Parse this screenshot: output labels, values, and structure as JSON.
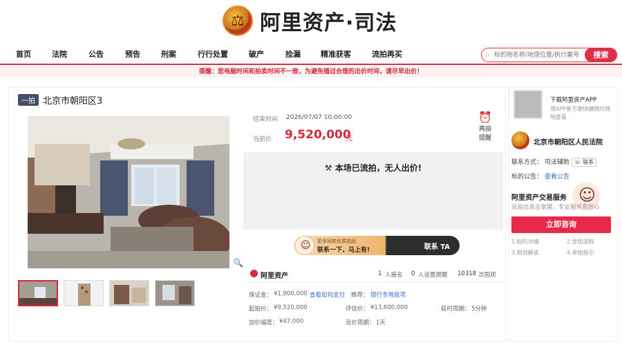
{
  "header": {
    "logo_text": "阿里资产·司法"
  },
  "nav": {
    "items": [
      "首页",
      "法院",
      "公告",
      "预告",
      "刑案",
      "行行处置",
      "破产",
      "捡漏",
      "精准获客",
      "流拍再买"
    ]
  },
  "search": {
    "placeholder": "标的物名称/地理位置/执行案号",
    "button": "搜索"
  },
  "notice": "提醒：您电脑时间和拍卖时间不一致，为避免错过合理的出价时间，请尽早出价！",
  "item": {
    "tag": "一拍",
    "title": "北京市朝阳区3",
    "end_label": "结束时间",
    "end_time": "2026/07/07 10:00:00",
    "current_label": "当前价",
    "current_price": "9,520,000",
    "currency_unit": "元",
    "remind_label_1": "再拍",
    "remind_label_2": "提醒",
    "status_text": "本场已流拍，无人出价!"
  },
  "contact": {
    "line1": "更多同类优质拍品",
    "line2": "联系一下，马上有!",
    "button": "联系 TA"
  },
  "stats": {
    "brand": "阿里资产",
    "signups": "1",
    "signups_label": "人报名",
    "reminders": "0",
    "reminders_label": "人设置提醒",
    "views": "10318",
    "views_label": "次围观"
  },
  "details": {
    "deposit_label": "保证金：",
    "deposit_value": "¥1,900,000",
    "pay_link": "查看如何支付",
    "recommend_label": "推荐：",
    "recommend_link": "银行专用款项",
    "start_label": "起拍价：",
    "start_value": "¥9,520,000",
    "appraisal_label": "评估价：",
    "appraisal_value": "¥13,600,000",
    "delay_label": "延时周期：",
    "delay_value": "5分钟",
    "increment_label": "加价幅度：",
    "increment_value": "¥47,000",
    "bid_period_label": "竞价周期：",
    "bid_period_value": "1天"
  },
  "sidebar": {
    "app_title": "下载阿里资产APP",
    "app_sub": "用APP更方便快捷随时随地查看",
    "court_name": "北京市朝阳区人民法院",
    "contact_label": "联系方式：",
    "contact_value": "司法辅助",
    "contact_chip": "联系",
    "announce_label": "标的公告：",
    "announce_link": "查看公告",
    "svc_title": "阿里资产交易服务",
    "svc_sub": "竞拍信息全掌握，专业服务更放心",
    "consult_button": "立即咨询",
    "steps": [
      "1.标的详情",
      "2.竞拍流程",
      "3.规则解读",
      "4.参拍指引"
    ]
  },
  "colors": {
    "accent": "#d12b3d",
    "nav_border": "#d9334b",
    "link": "#3b6fc8"
  }
}
